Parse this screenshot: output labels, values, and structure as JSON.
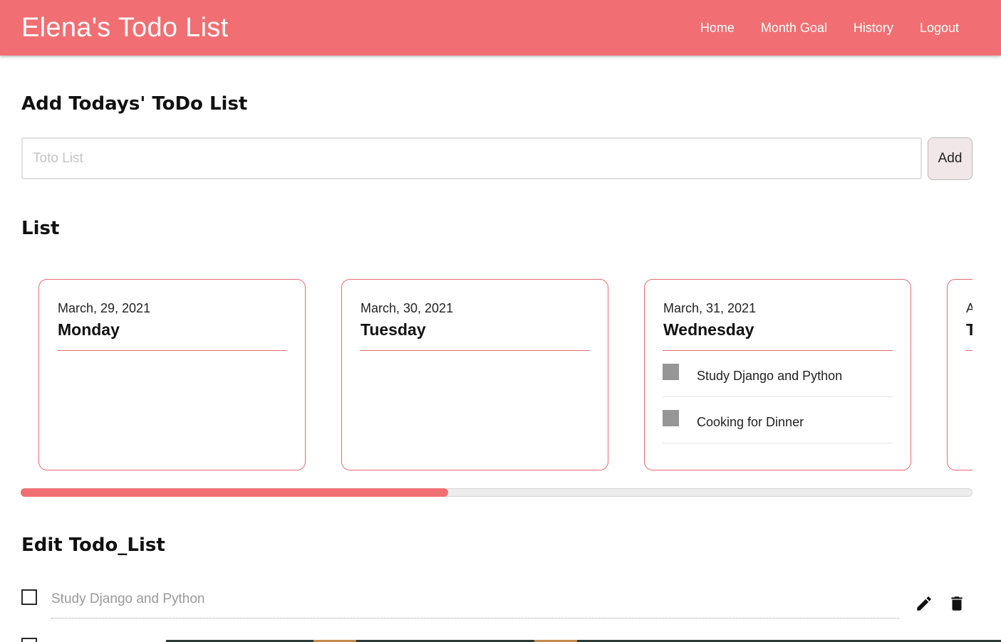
{
  "header": {
    "brand": "Elena's Todo List",
    "nav": [
      "Home",
      "Month Goal",
      "History",
      "Logout"
    ]
  },
  "add_section": {
    "title": "Add Todays' ToDo List",
    "input_placeholder": "Toto List",
    "input_value": "",
    "add_label": "Add"
  },
  "list_section": {
    "title": "List",
    "cards": [
      {
        "date": "March, 29, 2021",
        "day": "Monday",
        "items": []
      },
      {
        "date": "March, 30, 2021",
        "day": "Tuesday",
        "items": []
      },
      {
        "date": "March, 31, 2021",
        "day": "Wednesday",
        "items": [
          "Study Django and Python",
          "Cooking for Dinner"
        ]
      },
      {
        "date": "A",
        "day": "T",
        "items": []
      }
    ],
    "scroll_progress": 0.45
  },
  "edit_section": {
    "title": "Edit Todo_List",
    "rows": [
      {
        "text": "Study Django and Python",
        "checked": false,
        "edit_icon": "pencil-icon",
        "delete_icon": "trash-icon"
      }
    ]
  },
  "colors": {
    "accent": "#f16f72",
    "card_border": "#e86b72",
    "item_marker": "#969696"
  }
}
